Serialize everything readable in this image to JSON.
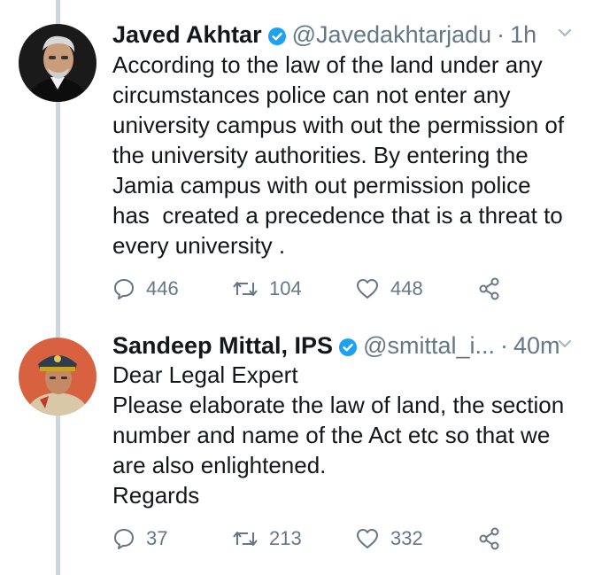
{
  "tweets": [
    {
      "author_name": "Javed Akhtar",
      "handle": "@Javedakhtarjadu",
      "separator": "·",
      "time": "1h",
      "text": "According to the law of the land under any\ncircumstances police can not enter any\nuniversity campus with out the permission of\nthe university authorities. By entering the\nJamia campus with out permission police\nhas  created a precedence that is a threat to\nevery university .",
      "replies": "446",
      "retweets": "104",
      "likes": "448"
    },
    {
      "author_name": "Sandeep Mittal, IPS",
      "handle": "@smittal_i...",
      "separator": "·",
      "time": "40m",
      "text": "Dear Legal Expert\nPlease elaborate the law of land, the section\nnumber and name of the Act etc so that we\nare also enlightened.\nRegards",
      "replies": "37",
      "retweets": "213",
      "likes": "332"
    }
  ],
  "colors": {
    "text": "#14171a",
    "secondary": "#657786",
    "verified": "#1da1f2",
    "thread_line": "#ccd6dd"
  },
  "icons": [
    "verified-badge-icon",
    "chevron-down-icon",
    "reply-icon",
    "retweet-icon",
    "like-icon",
    "share-icon"
  ]
}
